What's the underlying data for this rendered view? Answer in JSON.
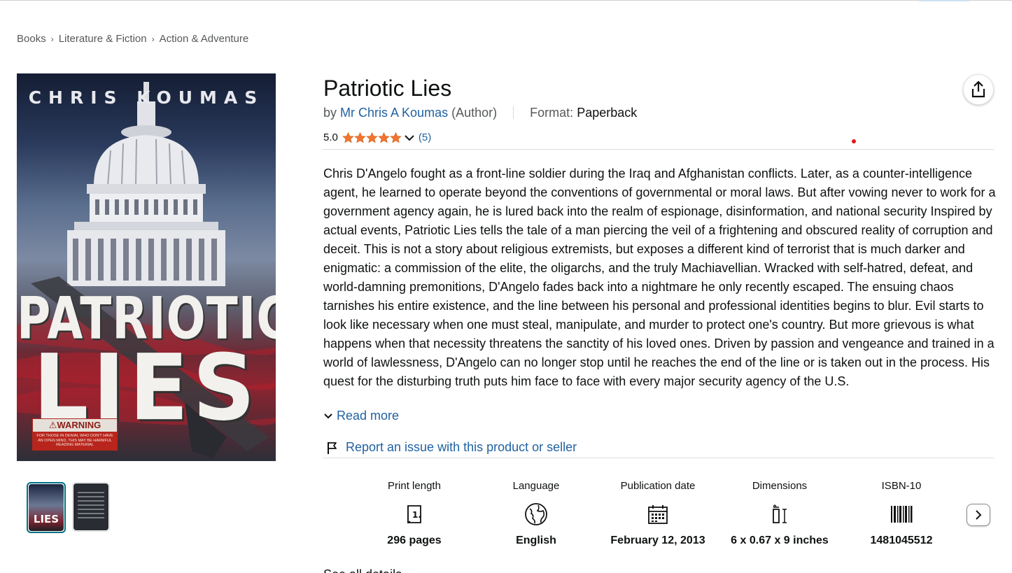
{
  "breadcrumb": [
    "Books",
    "Literature & Fiction",
    "Action & Adventure"
  ],
  "cover": {
    "author_text": "CHRIS KOUMAS",
    "title_line1": "PATRIOTIC",
    "title_line2": "LIES",
    "warning_heading": "⚠WARNING",
    "warning_body": "FOR THOSE IN DENIAL WHO DON'T HAVE AN OPEN MIND, THIS MAY BE HARMFUL READING MATERIAL",
    "thumb1_text": "LIES"
  },
  "product": {
    "title": "Patriotic Lies",
    "by_label": "by",
    "author": "Mr Chris A Koumas",
    "author_role": "(Author)",
    "format_label": "Format:",
    "format_value": "Paperback",
    "rating_score": "5.0",
    "rating_stars": 5,
    "rating_count": "(5)"
  },
  "description": "Chris D'Angelo fought as a front-line soldier during the Iraq and Afghanistan conflicts. Later, as a counter-intelligence agent, he learned to operate beyond the conventions of governmental or moral laws. But after vowing never to work for a government agency again, he is lured back into the realm of espionage, disinformation, and national security Inspired by actual events, Patriotic Lies tells the tale of a man piercing the veil of a frightening and obscured reality of corruption and deceit. This is not a story about religious extremists, but exposes a different kind of terrorist that is much darker and enigmatic: a commission of the elite, the oligarchs, and the truly Machiavellian. Wracked with self-hatred, defeat, and world-damning premonitions, D'Angelo fades back into a nightmare he only recently escaped. The ensuing chaos tarnishes his entire existence, and the line between his personal and professional identities begins to blur. Evil starts to look like necessary when one must steal, manipulate, and murder to protect one's country. But more grievous is what happens when that necessity threatens the sanctity of his loved ones. Driven by passion and vengeance and trained in a world of lawlessness, D'Angelo can no longer stop until he reaches the end of the line or is taken out in the process. His quest for the disturbing truth puts him face to face with every major security agency of the U.S.",
  "read_more": "Read more",
  "report_issue": "Report an issue with this product or seller",
  "details": [
    {
      "label": "Print length",
      "icon": "book-page-icon",
      "value": "296 pages"
    },
    {
      "label": "Language",
      "icon": "globe-icon",
      "value": "English"
    },
    {
      "label": "Publication date",
      "icon": "calendar-icon",
      "value": "February 12, 2013"
    },
    {
      "label": "Dimensions",
      "icon": "dimensions-icon",
      "value": "6 x 0.67 x 9 inches"
    },
    {
      "label": "ISBN-10",
      "icon": "barcode-icon",
      "value": "1481045512"
    }
  ],
  "see_all_details": "See all details",
  "colors": {
    "link": "#2162a1",
    "star": "#f3742d",
    "text": "#0f1111",
    "muted": "#565959"
  }
}
